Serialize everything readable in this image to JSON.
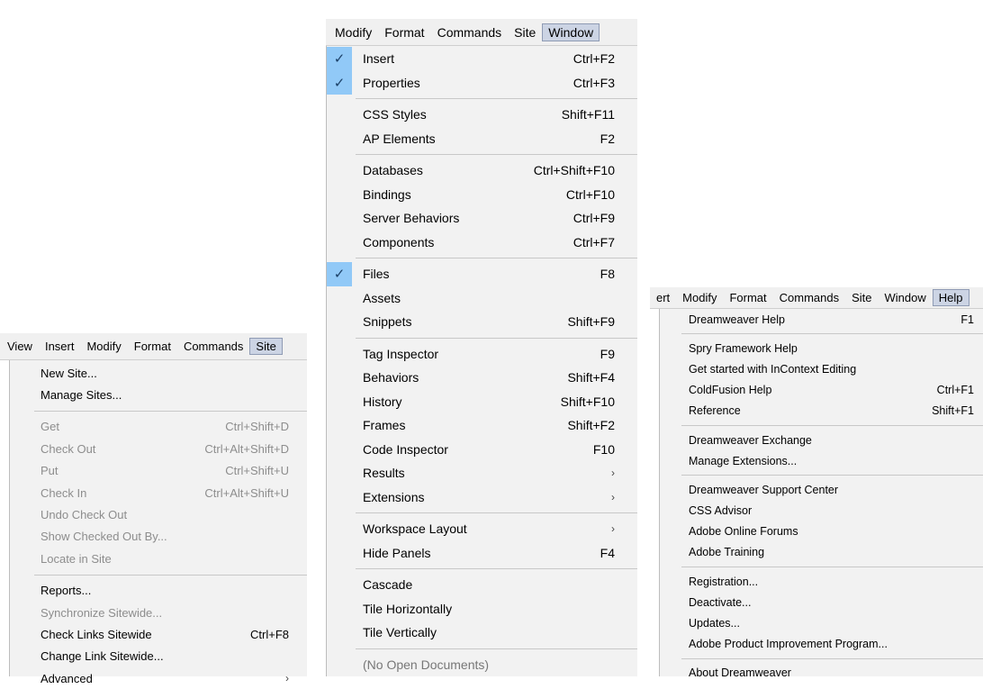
{
  "menu_site": {
    "menubar": [
      "View",
      "Insert",
      "Modify",
      "Format",
      "Commands",
      "Site"
    ],
    "items": [
      {
        "label": "New Site...",
        "shortcut": ""
      },
      {
        "label": "Manage Sites...",
        "shortcut": ""
      },
      {
        "label": "Get",
        "shortcut": "Ctrl+Shift+D"
      },
      {
        "label": "Check Out",
        "shortcut": "Ctrl+Alt+Shift+D"
      },
      {
        "label": "Put",
        "shortcut": "Ctrl+Shift+U"
      },
      {
        "label": "Check In",
        "shortcut": "Ctrl+Alt+Shift+U"
      },
      {
        "label": "Undo Check Out",
        "shortcut": ""
      },
      {
        "label": "Show Checked Out By...",
        "shortcut": ""
      },
      {
        "label": "Locate in Site",
        "shortcut": ""
      },
      {
        "label": "Reports...",
        "shortcut": ""
      },
      {
        "label": "Synchronize Sitewide...",
        "shortcut": ""
      },
      {
        "label": "Check Links Sitewide",
        "shortcut": "Ctrl+F8"
      },
      {
        "label": "Change Link Sitewide...",
        "shortcut": ""
      },
      {
        "label": "Advanced",
        "shortcut": ""
      }
    ]
  },
  "menu_window": {
    "menubar": [
      "Modify",
      "Format",
      "Commands",
      "Site",
      "Window"
    ],
    "items": [
      {
        "label": "Insert",
        "shortcut": "Ctrl+F2"
      },
      {
        "label": "Properties",
        "shortcut": "Ctrl+F3"
      },
      {
        "label": "CSS Styles",
        "shortcut": "Shift+F11"
      },
      {
        "label": "AP Elements",
        "shortcut": "F2"
      },
      {
        "label": "Databases",
        "shortcut": "Ctrl+Shift+F10"
      },
      {
        "label": "Bindings",
        "shortcut": "Ctrl+F10"
      },
      {
        "label": "Server Behaviors",
        "shortcut": "Ctrl+F9"
      },
      {
        "label": "Components",
        "shortcut": "Ctrl+F7"
      },
      {
        "label": "Files",
        "shortcut": "F8"
      },
      {
        "label": "Assets",
        "shortcut": ""
      },
      {
        "label": "Snippets",
        "shortcut": "Shift+F9"
      },
      {
        "label": "Tag Inspector",
        "shortcut": "F9"
      },
      {
        "label": "Behaviors",
        "shortcut": "Shift+F4"
      },
      {
        "label": "History",
        "shortcut": "Shift+F10"
      },
      {
        "label": "Frames",
        "shortcut": "Shift+F2"
      },
      {
        "label": "Code Inspector",
        "shortcut": "F10"
      },
      {
        "label": "Results",
        "shortcut": ""
      },
      {
        "label": "Extensions",
        "shortcut": ""
      },
      {
        "label": "Workspace Layout",
        "shortcut": ""
      },
      {
        "label": "Hide Panels",
        "shortcut": "F4"
      },
      {
        "label": "Cascade",
        "shortcut": ""
      },
      {
        "label": "Tile Horizontally",
        "shortcut": ""
      },
      {
        "label": "Tile Vertically",
        "shortcut": ""
      },
      {
        "label": "(No Open Documents)",
        "shortcut": ""
      }
    ]
  },
  "menu_help": {
    "menubar": [
      "ert",
      "Modify",
      "Format",
      "Commands",
      "Site",
      "Window",
      "Help"
    ],
    "items": [
      {
        "label": "Dreamweaver Help",
        "shortcut": "F1"
      },
      {
        "label": "Spry Framework Help",
        "shortcut": ""
      },
      {
        "label": "Get started with InContext Editing",
        "shortcut": ""
      },
      {
        "label": "ColdFusion Help",
        "shortcut": "Ctrl+F1"
      },
      {
        "label": "Reference",
        "shortcut": "Shift+F1"
      },
      {
        "label": "Dreamweaver Exchange",
        "shortcut": ""
      },
      {
        "label": "Manage Extensions...",
        "shortcut": ""
      },
      {
        "label": "Dreamweaver Support Center",
        "shortcut": ""
      },
      {
        "label": "CSS Advisor",
        "shortcut": ""
      },
      {
        "label": "Adobe Online Forums",
        "shortcut": ""
      },
      {
        "label": "Adobe Training",
        "shortcut": ""
      },
      {
        "label": "Registration...",
        "shortcut": ""
      },
      {
        "label": "Deactivate...",
        "shortcut": ""
      },
      {
        "label": "Updates...",
        "shortcut": ""
      },
      {
        "label": "Adobe Product Improvement Program...",
        "shortcut": ""
      },
      {
        "label": "About Dreamweaver",
        "shortcut": ""
      }
    ]
  },
  "glyphs": {
    "check": "✓",
    "submenu_arrow": "›"
  },
  "colors": {
    "menu_bg": "#f2f2f2",
    "check_highlight": "#91c9f7",
    "active_menu": "#ccd4e4",
    "disabled_text": "#8d8d8d"
  }
}
